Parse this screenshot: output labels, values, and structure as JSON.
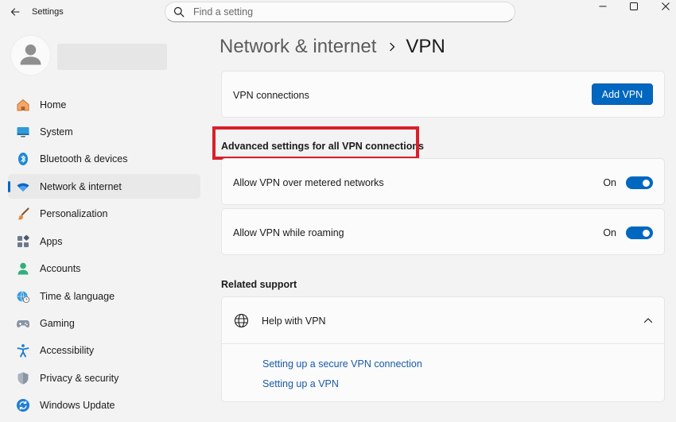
{
  "window": {
    "title": "Settings"
  },
  "search": {
    "placeholder": "Find a setting",
    "value": ""
  },
  "sidebar": {
    "items": [
      {
        "label": "Home",
        "icon": "home-icon",
        "active": false
      },
      {
        "label": "System",
        "icon": "system-icon",
        "active": false
      },
      {
        "label": "Bluetooth & devices",
        "icon": "bluetooth-icon",
        "active": false
      },
      {
        "label": "Network & internet",
        "icon": "wifi-icon",
        "active": true
      },
      {
        "label": "Personalization",
        "icon": "brush-icon",
        "active": false
      },
      {
        "label": "Apps",
        "icon": "apps-icon",
        "active": false
      },
      {
        "label": "Accounts",
        "icon": "accounts-icon",
        "active": false
      },
      {
        "label": "Time & language",
        "icon": "globe-clock-icon",
        "active": false
      },
      {
        "label": "Gaming",
        "icon": "gamepad-icon",
        "active": false
      },
      {
        "label": "Accessibility",
        "icon": "accessibility-icon",
        "active": false
      },
      {
        "label": "Privacy & security",
        "icon": "shield-icon",
        "active": false
      },
      {
        "label": "Windows Update",
        "icon": "update-icon",
        "active": false
      }
    ]
  },
  "breadcrumb": {
    "parent": "Network & internet",
    "current": "VPN"
  },
  "vpn_connections": {
    "label": "VPN connections",
    "button": "Add VPN"
  },
  "advanced": {
    "title": "Advanced settings for all VPN connections",
    "settings": [
      {
        "label": "Allow VPN over metered networks",
        "state": "On",
        "enabled": true
      },
      {
        "label": "Allow VPN while roaming",
        "state": "On",
        "enabled": true
      }
    ]
  },
  "related": {
    "title": "Related support",
    "help_label": "Help with VPN",
    "links": [
      "Setting up a secure VPN connection",
      "Setting up a VPN"
    ]
  },
  "colors": {
    "accent": "#0067c0",
    "highlight": "#d9202a",
    "link": "#1a5aa8"
  }
}
